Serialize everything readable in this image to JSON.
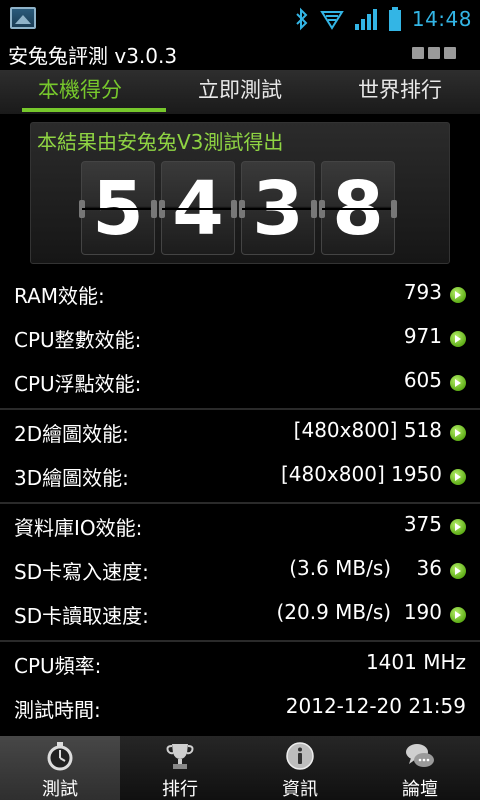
{
  "status_bar": {
    "time": "14:48",
    "icons": [
      "gallery-icon",
      "bluetooth-icon",
      "wifi-icon",
      "signal-icon",
      "battery-icon"
    ]
  },
  "app": {
    "title": "安兔兔評測 v3.0.3"
  },
  "tabs": [
    {
      "label": "本機得分",
      "active": true
    },
    {
      "label": "立即測試",
      "active": false
    },
    {
      "label": "世界排行",
      "active": false
    }
  ],
  "score": {
    "caption": "本結果由安兔兔V3測試得出",
    "digits": [
      "5",
      "4",
      "3",
      "8"
    ]
  },
  "results": [
    {
      "label": "RAM效能:",
      "value": "793"
    },
    {
      "label": "CPU整數效能:",
      "value": "971"
    },
    {
      "label": "CPU浮點效能:",
      "value": "605"
    },
    {
      "label": "2D繪圖效能:",
      "value": "[480x800] 518"
    },
    {
      "label": "3D繪圖效能:",
      "value": "[480x800] 1950"
    },
    {
      "label": "資料庫IO效能:",
      "value": "375"
    },
    {
      "label": "SD卡寫入速度:",
      "value": "(3.6 MB/s)    36"
    },
    {
      "label": "SD卡讀取速度:",
      "value": "(20.9 MB/s)  190"
    },
    {
      "label": "CPU頻率:",
      "value": "1401 MHz"
    },
    {
      "label": "測試時間:",
      "value": "2012-12-20 21:59"
    }
  ],
  "bottom_nav": [
    {
      "label": "測試",
      "icon": "stopwatch-icon",
      "active": true
    },
    {
      "label": "排行",
      "icon": "trophy-icon",
      "active": false
    },
    {
      "label": "資訊",
      "icon": "info-icon",
      "active": false
    },
    {
      "label": "論壇",
      "icon": "chat-bubbles-icon",
      "active": false
    }
  ],
  "colors": {
    "accent_green": "#77c82c",
    "caption_green": "#8fd443",
    "clock_blue": "#33b5e5"
  }
}
